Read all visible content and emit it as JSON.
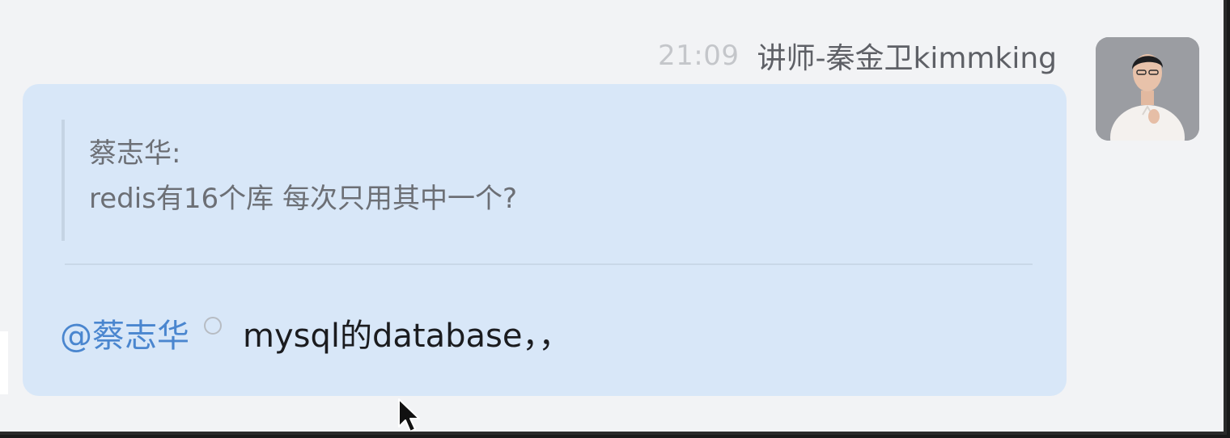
{
  "message": {
    "timestamp": "21:09",
    "sender": "讲师-秦金卫kimmking",
    "quote": {
      "author": "蔡志华:",
      "text": "redis有16个库 每次只用其中一个?"
    },
    "reply": {
      "mention": "@蔡志华",
      "text": "mysql的database，，"
    }
  },
  "icons": {
    "avatar": "person-avatar",
    "status": "read-status-circle-icon",
    "cursor": "mouse-pointer-icon"
  },
  "colors": {
    "bubble": "#d8e7f8",
    "mention": "#4a86cf",
    "background": "#f2f3f5"
  }
}
